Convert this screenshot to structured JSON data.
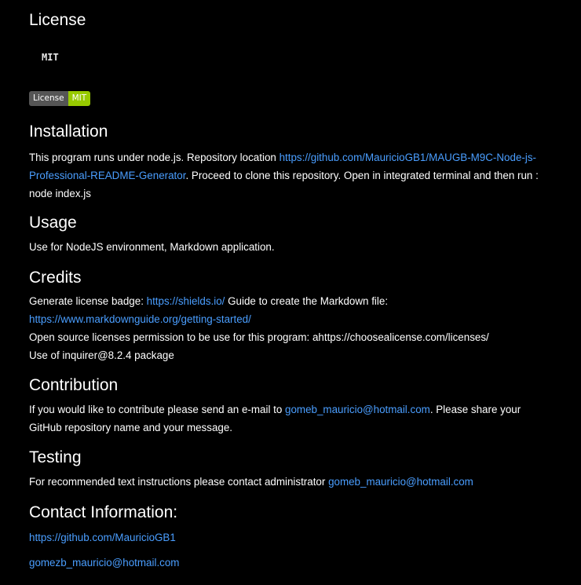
{
  "license": {
    "heading": "License",
    "code": "MIT",
    "badge_label": "License",
    "badge_value": "MIT"
  },
  "installation": {
    "heading": "Installation",
    "text_before": "This program runs under node.js. Repository location ",
    "link": "https://github.com/MauricioGB1/MAUGB-M9C-Node-js-Professional-README-Generator",
    "link_line1": "https://github.com/MauricioGB1/MAUGB-M9C-Node-js-",
    "link_line2": "Professional-README-Generator",
    "text_after": ". Proceed to clone this repository. Open in integrated terminal and then run :",
    "command": "node index.js"
  },
  "usage": {
    "heading": "Usage",
    "text": "Use for NodeJS environment, Markdown application."
  },
  "credits": {
    "heading": "Credits",
    "line1_prefix": "Generate license badge: ",
    "line1_link": "https://shields.io/",
    "line1_suffix": " Guide to create the Markdown file:",
    "line2_link": "https://www.markdownguide.org/getting-started/",
    "line3": "Open source licenses permission to be use for this program: ahttps://choosealicense.com/licenses/",
    "line4": "Use of inquirer@8.2.4 package"
  },
  "contribution": {
    "heading": "Contribution",
    "prefix": "If you would like to contribute please send an e-mail to ",
    "email": "gomeb_mauricio@hotmail.com",
    "suffix_line1": ". Please share your",
    "suffix_line2": "GitHub repository name and your message."
  },
  "testing": {
    "heading": "Testing",
    "prefix": "For recommended text instructions please contact administrator ",
    "email": "gomeb_mauricio@hotmail.com"
  },
  "contact": {
    "heading": "Contact Information:",
    "github": "https://github.com/MauricioGB1",
    "email": "gomezb_mauricio@hotmail.com"
  },
  "colors": {
    "background": "#000000",
    "text": "#ffffff",
    "link": "#4a9eff",
    "badge_label_bg": "#555555",
    "badge_value_bg": "#97ca00"
  }
}
